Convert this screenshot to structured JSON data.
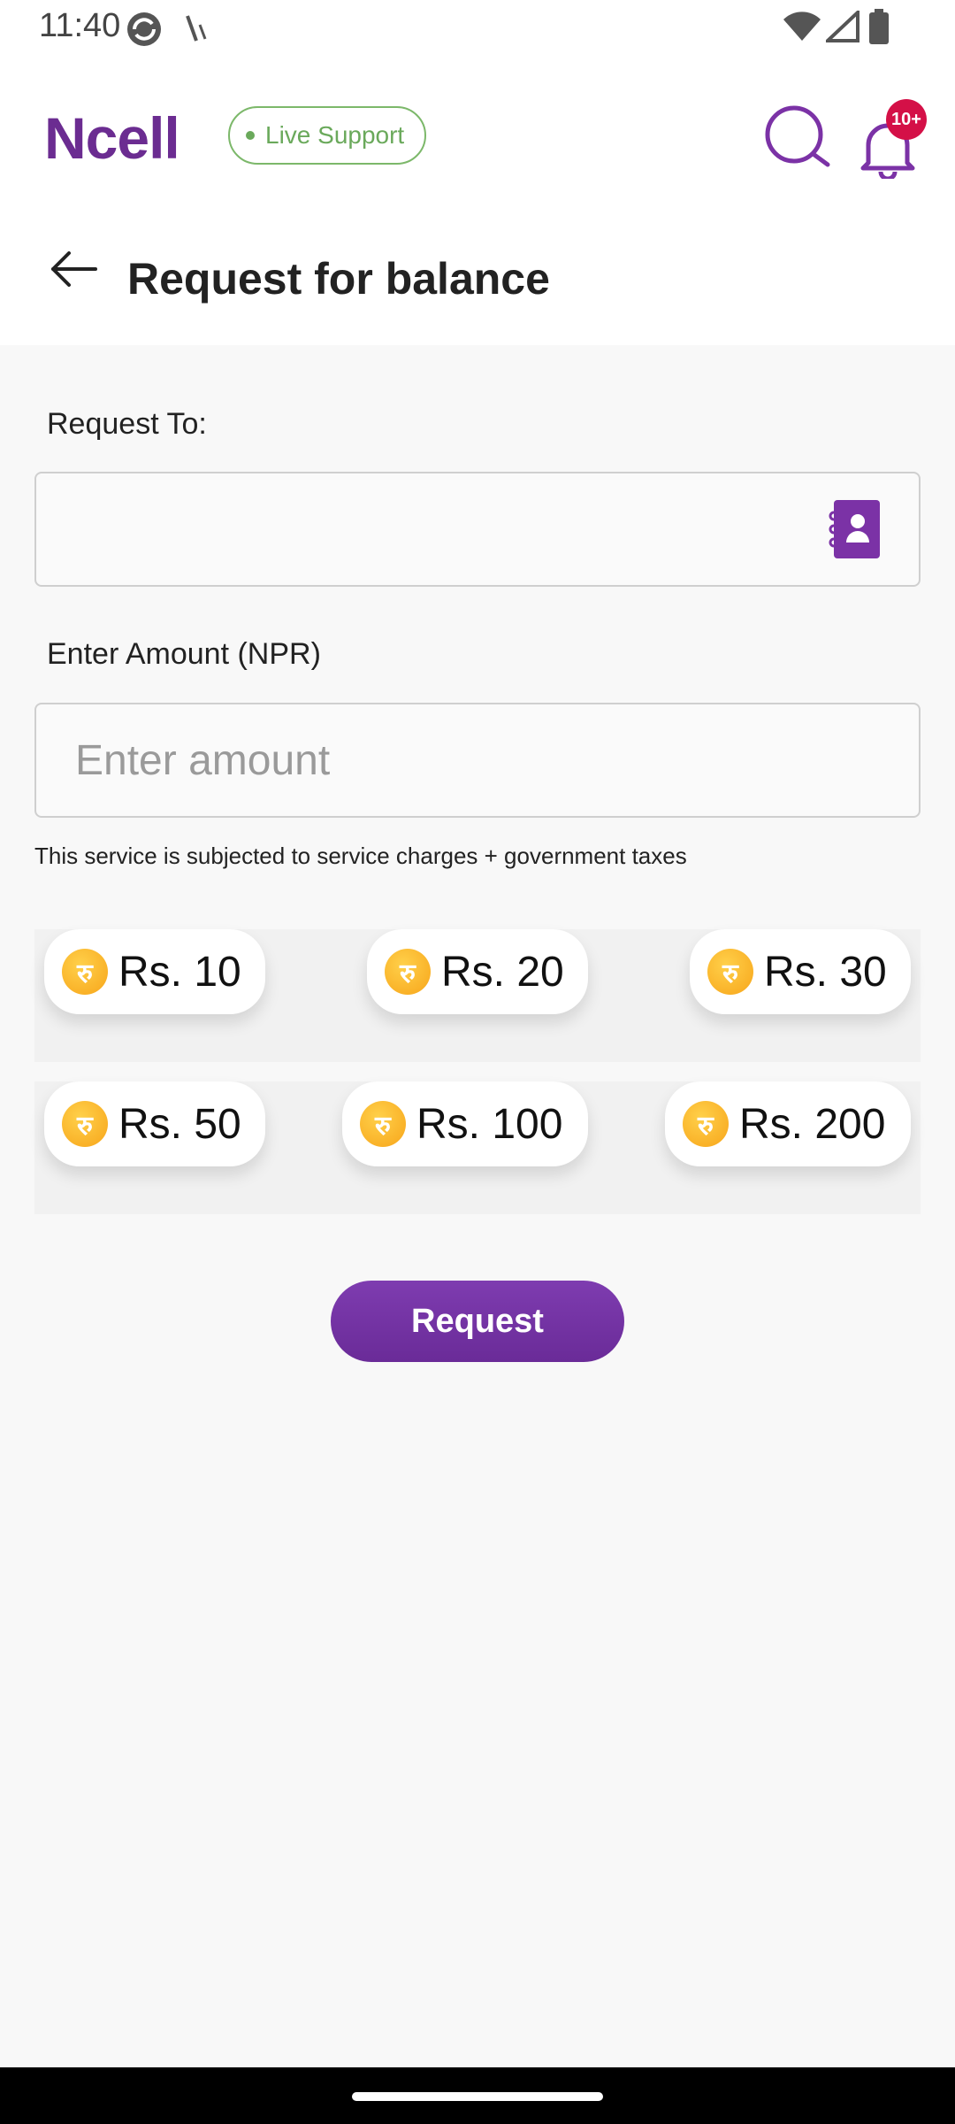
{
  "status_bar": {
    "time": "11:40"
  },
  "header": {
    "logo": "Ncell",
    "live_support": "Live Support",
    "notification_badge": "10+",
    "page_title": "Request for balance"
  },
  "form": {
    "request_to_label": "Request To:",
    "request_to_value": "",
    "amount_label": "Enter Amount (NPR)",
    "amount_placeholder": "Enter amount",
    "note": "This service is subjected to service charges + government taxes"
  },
  "amount_chips": [
    {
      "coin_symbol": "रु",
      "label": "Rs. 10"
    },
    {
      "coin_symbol": "रु",
      "label": "Rs. 20"
    },
    {
      "coin_symbol": "रु",
      "label": "Rs. 30"
    },
    {
      "coin_symbol": "रु",
      "label": "Rs. 50"
    },
    {
      "coin_symbol": "रु",
      "label": "Rs. 100"
    },
    {
      "coin_symbol": "रु",
      "label": "Rs. 200"
    }
  ],
  "request_button": "Request",
  "colors": {
    "brand": "#6b2c91",
    "accent_green": "#6aa95b",
    "badge": "#d41047",
    "coin": "#f7a51a"
  }
}
